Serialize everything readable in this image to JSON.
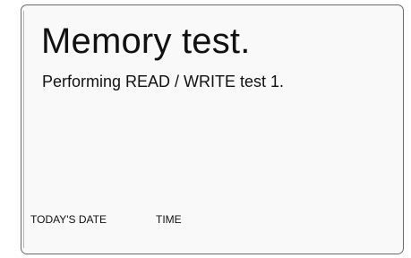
{
  "screen": {
    "title": "Memory test.",
    "status": "Performing READ / WRITE test 1.",
    "footer": {
      "date_label": "TODAY'S DATE",
      "time_label": "TIME"
    }
  },
  "colors": {
    "background": "#f9f9f9",
    "border": "#6b6b6b",
    "text": "#111111"
  }
}
